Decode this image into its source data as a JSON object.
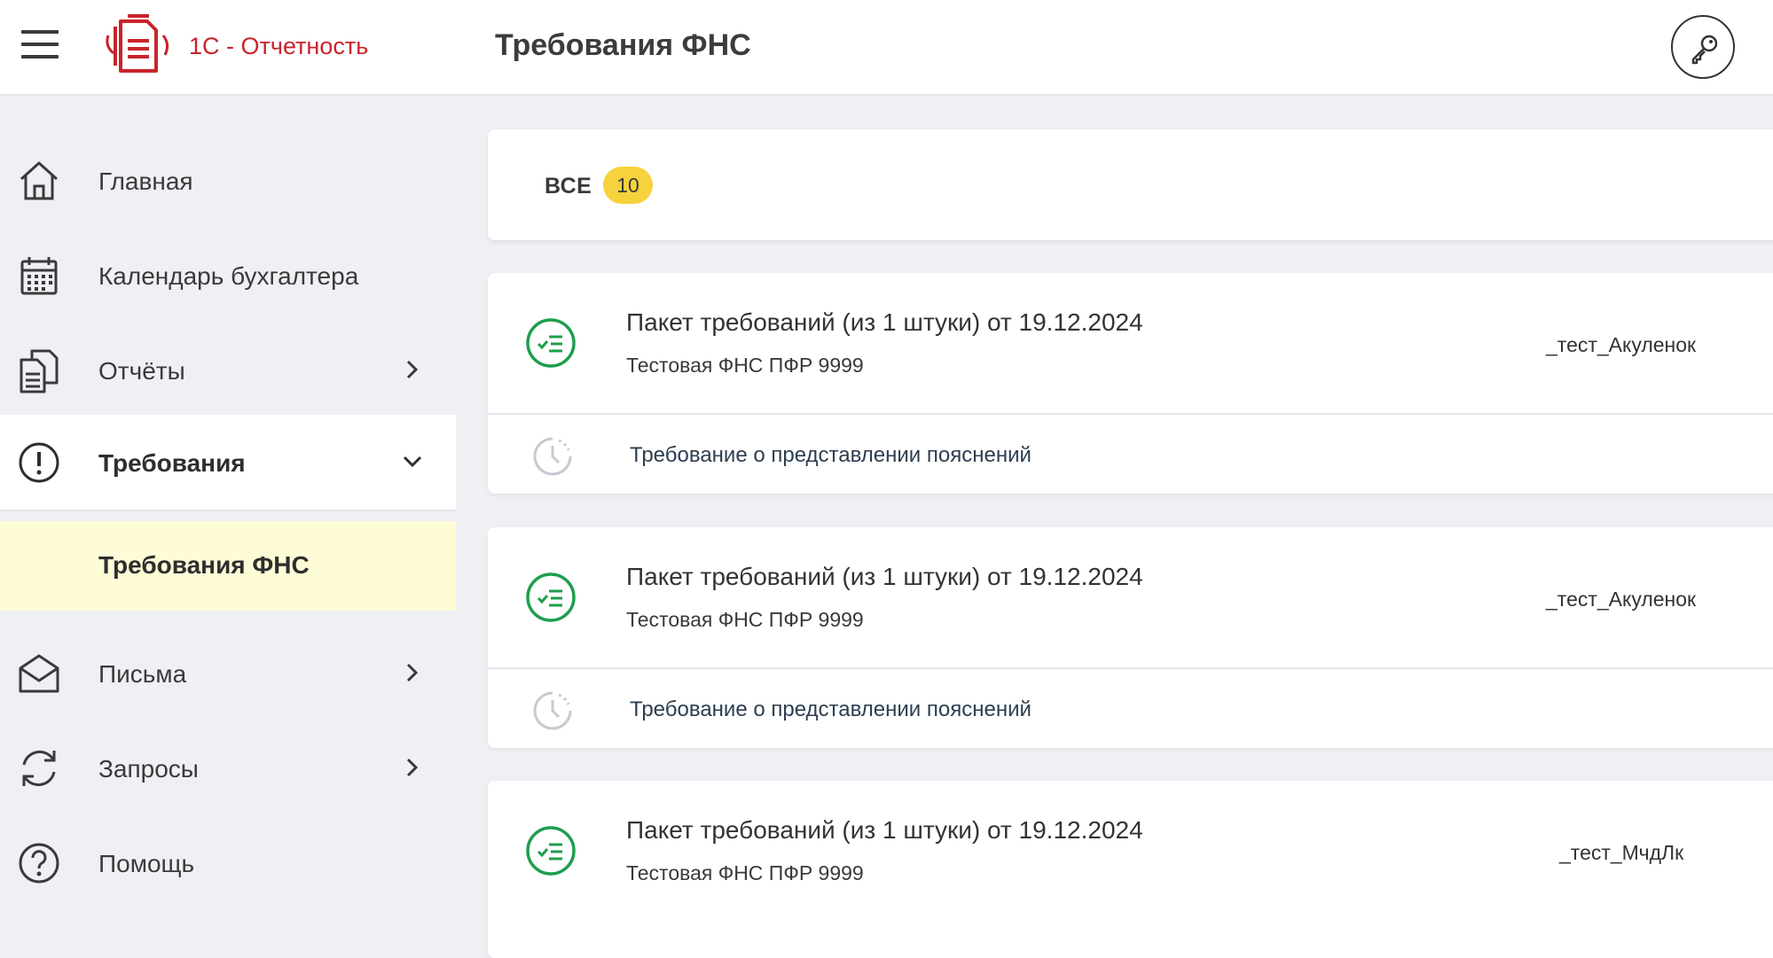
{
  "header": {
    "app_name": "1С - Отчетность",
    "page_title": "Требования ФНС",
    "menu_icon": "hamburger-menu-icon",
    "logo_icon": "reports-document-logo-icon",
    "key_icon": "key-icon",
    "brand_color": "#c8242c"
  },
  "sidebar": {
    "items": [
      {
        "label": "Главная",
        "icon": "home-icon"
      },
      {
        "label": "Календарь бухгалтера",
        "icon": "calendar-icon"
      },
      {
        "label": "Отчёты",
        "icon": "reports-icon"
      },
      {
        "label": "Требования",
        "icon": "exclamation-circle-icon"
      },
      {
        "label": "Письма",
        "icon": "envelope-icon"
      },
      {
        "label": "Запросы",
        "icon": "refresh-icon"
      },
      {
        "label": "Помощь",
        "icon": "question-circle-icon"
      }
    ],
    "active_sub": "Требования ФНС",
    "active_sub_bg": "#fefbd7"
  },
  "filter": {
    "tab_label": "ВСЕ",
    "count": "10",
    "badge_color": "#f6d23c"
  },
  "requirements": [
    {
      "title": "Пакет требований (из 1 штуки) от 19.12.2024",
      "authority": "Тестовая ФНС ПФР  9999",
      "user": "_тест_Акуленок",
      "item_text": "Требование о представлении пояснений",
      "status_icon": "checklist-done-icon"
    },
    {
      "title": "Пакет требований (из 1 штуки) от 19.12.2024",
      "authority": "Тестовая ФНС ПФР  9999",
      "user": "_тест_Акуленок",
      "item_text": "Требование о представлении пояснений",
      "status_icon": "checklist-done-icon"
    },
    {
      "title": "Пакет требований (из 1 штуки) от 19.12.2024",
      "authority": "Тестовая ФНС ПФР  9999",
      "user": "_тест_МчдЛк",
      "status_icon": "checklist-done-icon"
    }
  ],
  "status_color": "#1e9e4c"
}
